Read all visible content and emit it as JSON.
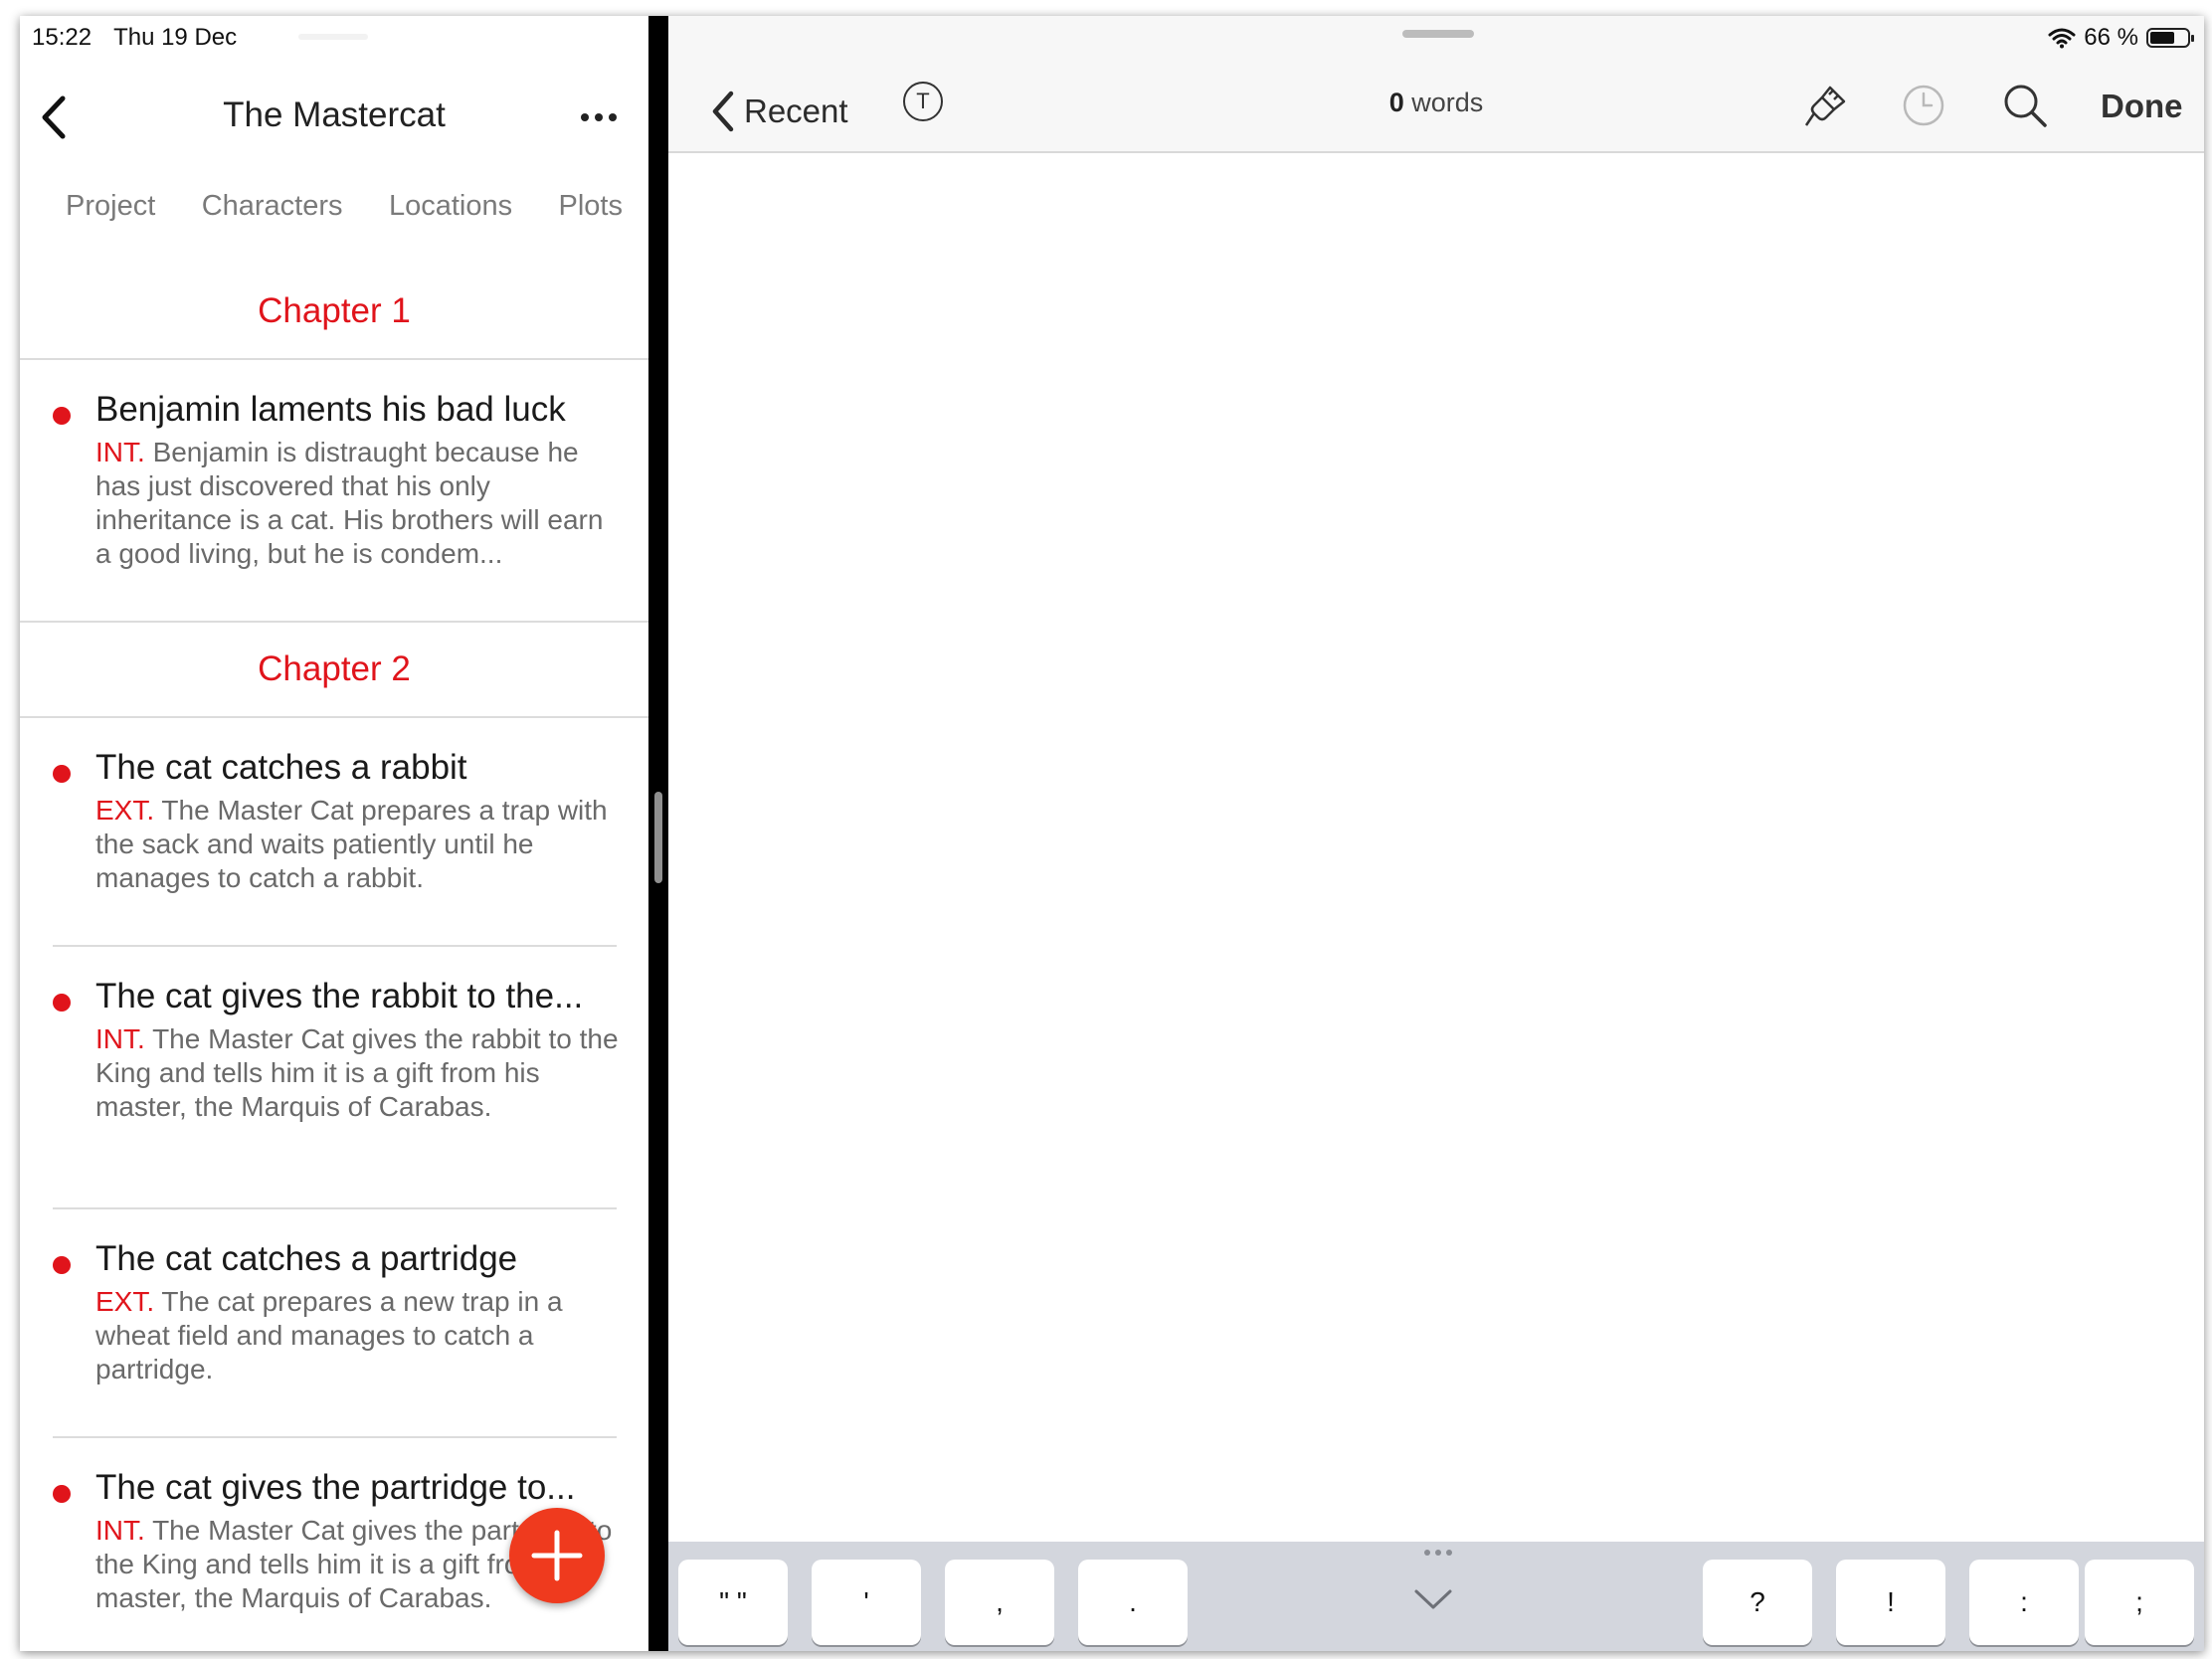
{
  "status": {
    "time": "15:22",
    "date": "Thu 19 Dec",
    "battery": "66 %",
    "battery_level": 0.66
  },
  "left": {
    "title": "The Mastercat",
    "tabs": [
      "Project",
      "Characters",
      "Locations",
      "Plots"
    ],
    "chapters": [
      {
        "title": "Chapter 1",
        "scenes": [
          {
            "title": "Benjamin laments his bad luck",
            "location": "INT.",
            "description": "Benjamin is distraught because he has just discovered that his only inheritance is a cat. His brothers will earn a good living, but he is condem..."
          }
        ]
      },
      {
        "title": "Chapter 2",
        "scenes": [
          {
            "title": "The cat catches a rabbit",
            "location": "EXT.",
            "description": "The Master Cat prepares a trap with the sack and waits patiently until he manages to catch a rabbit."
          },
          {
            "title": "The cat gives the rabbit to the...",
            "location": "INT.",
            "description": "The Master Cat gives the rabbit to the King and tells him it is a gift from his master, the Marquis of Carabas."
          },
          {
            "title": "The cat catches a partridge",
            "location": "EXT.",
            "description": "The cat prepares a new trap in a wheat field and manages to catch a partridge."
          },
          {
            "title": "The cat gives the partridge to...",
            "location": "INT.",
            "description": "The Master Cat gives the partridge to the King and tells him it is a gift from his master, the Marquis of Carabas."
          }
        ]
      }
    ]
  },
  "right": {
    "back_label": "Recent",
    "t_button": "T",
    "word_count": "0",
    "word_unit": "words",
    "done_label": "Done",
    "keys_left": [
      "\" \"",
      "'",
      ",",
      "."
    ],
    "keys_right": [
      "?",
      "!",
      ":",
      ";"
    ]
  },
  "colors": {
    "accent": "#e0141b",
    "fab": "#ef3a1e",
    "keyboard_bar": "#d3d6dd"
  }
}
